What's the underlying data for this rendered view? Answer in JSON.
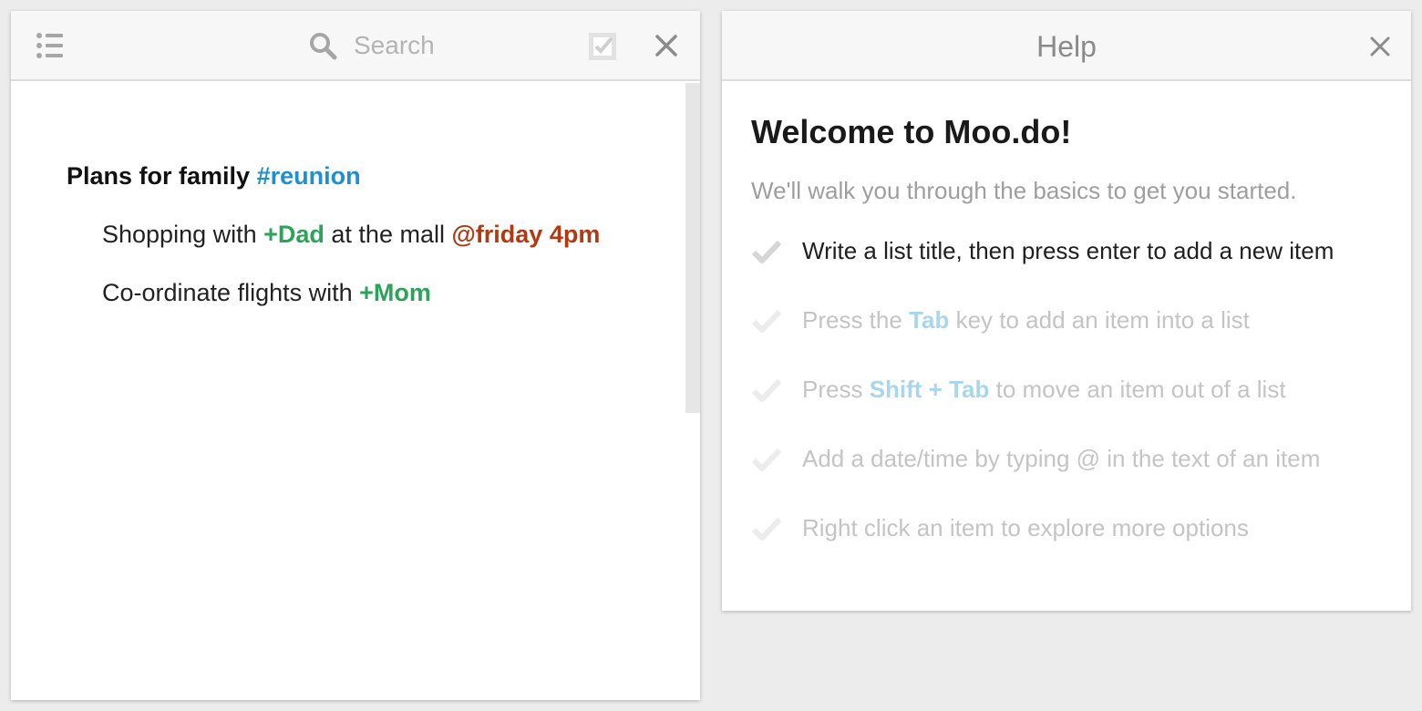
{
  "left_panel": {
    "search_placeholder": "Search",
    "list": {
      "title_text": "Plans for family ",
      "title_tag": "#reunion",
      "items": [
        {
          "part1": "Shopping with ",
          "person": "+Dad",
          "part2": " at the mall ",
          "date": "@friday 4pm"
        },
        {
          "part1": "Co-ordinate flights with ",
          "person": "+Mom"
        }
      ]
    }
  },
  "help_panel": {
    "title": "Help",
    "heading": "Welcome to Moo.do!",
    "subtitle": "We'll walk you through the basics to get you started.",
    "steps": [
      {
        "text": "Write a list title, then press enter to add a new item",
        "state": "active"
      },
      {
        "before": "Press the ",
        "key": "Tab",
        "after": " key to add an item into a list",
        "state": "pending"
      },
      {
        "before": "Press ",
        "key": "Shift + Tab",
        "after": " to move an item out of a list",
        "state": "pending"
      },
      {
        "text": "Add a date/time by typing @ in the text of an item",
        "state": "pending"
      },
      {
        "text": "Right click an item to explore more options",
        "state": "pending"
      }
    ]
  },
  "icons": {
    "list": "list-icon",
    "search": "search-icon",
    "check": "check-box-icon",
    "close": "close-icon",
    "step_check": "checkmark-icon"
  },
  "colors": {
    "hashtag": "#1e90d2",
    "person": "#2da35a",
    "date": "#b23a12",
    "key": "#a8d6ee",
    "background": "#ececec"
  }
}
